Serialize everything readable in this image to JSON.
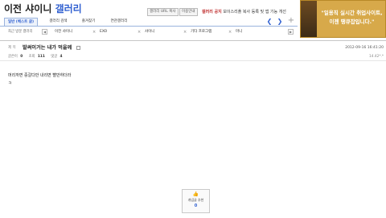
{
  "gallery": {
    "title_name": "이전 샤이니",
    "title_suffix": "갤러리",
    "url_button": "갤러리 URL 복사",
    "guide_button": "이용안내",
    "notice_label": "갤러리 공지",
    "notice_text": "보이스리플 복사 등록 및 앱 기능 개선"
  },
  "tabs": [
    {
      "label": "일반 (베스트 글)"
    },
    {
      "label": "갤러리 검색"
    },
    {
      "label": "즐겨찾기"
    },
    {
      "label": "연관갤러리"
    }
  ],
  "recent": {
    "label": "최근 방문 갤러리",
    "items": [
      "이전 샤이니",
      "EXO",
      "샤이니",
      "기타 프로그램",
      "마니"
    ]
  },
  "banner": {
    "line1": "\"일용직 실시간 취업사이트,",
    "line2": "이젠 땡큐잡입니다.\""
  },
  "post": {
    "label": "제 목",
    "subject": "발써이거는 내가 먹을께",
    "date": "2012-09-16 16:41:20",
    "name_label": "글쓴이",
    "name_value": "0",
    "views_label": "조회",
    "views_value": "111",
    "comments_label": "댓글",
    "comments_value": "4",
    "ip": "14.42*.*",
    "body_line1": "머리까면 중갈다만 내리면 빨만하더라",
    "body_line2": "ㅋ"
  },
  "recommend": {
    "label": "개념글 추천",
    "count": "0"
  },
  "colors": {
    "accent": "#2f5fd0",
    "banner": "#d7a94a"
  }
}
